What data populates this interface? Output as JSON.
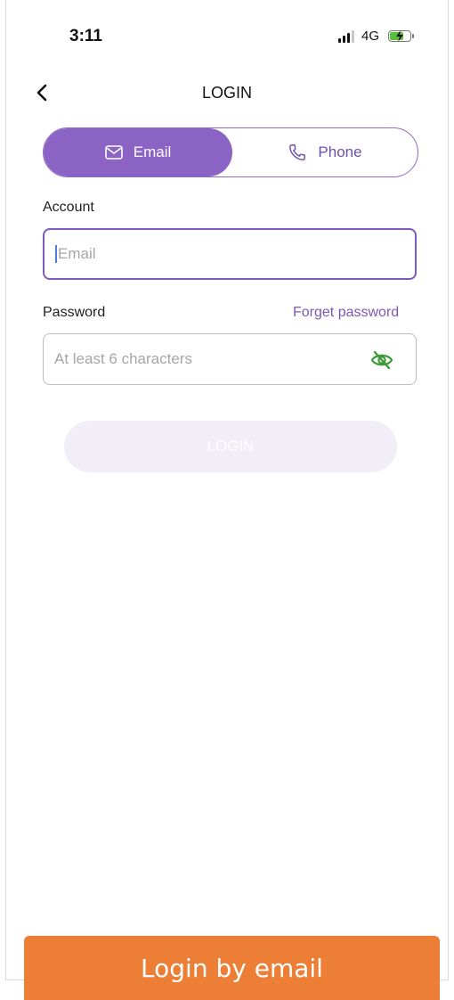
{
  "status_bar": {
    "time": "3:11",
    "network": "4G",
    "battery_charging": true
  },
  "header": {
    "title": "LOGIN",
    "back_icon": "chevron-left-icon"
  },
  "login_method": {
    "tabs": [
      {
        "label": "Email",
        "icon": "mail-icon",
        "active": true
      },
      {
        "label": "Phone",
        "icon": "phone-icon",
        "active": false
      }
    ]
  },
  "account": {
    "label": "Account",
    "placeholder": "Email",
    "value": ""
  },
  "password": {
    "label": "Password",
    "forget_link": "Forget password",
    "placeholder": "At least 6 characters",
    "value": "",
    "visibility_icon": "eye-off-icon"
  },
  "login_button": {
    "label": "LOGIN",
    "disabled": true
  },
  "caption": {
    "text": "Login by email"
  },
  "colors": {
    "accent": "#8a63c4",
    "link": "#7b57b8",
    "eye_icon": "#3f9a3a",
    "caption_bg": "#ec7f35",
    "button_disabled_bg": "#f1eef8"
  }
}
